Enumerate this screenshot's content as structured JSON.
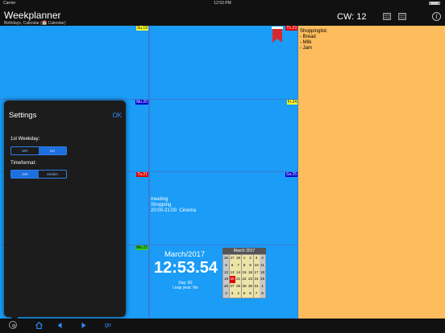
{
  "status_bar": {
    "carrier": "Carrier",
    "time": "12:53 PM"
  },
  "header": {
    "title": "Weekplanner",
    "subtitle": "Birthdays, Calendar (📅 Calendar)",
    "cw": "CW: 12",
    "icons": [
      "calendar-list-icon",
      "calendar-grid-icon",
      "info-icon"
    ]
  },
  "days": [
    {
      "badge": "Su.19",
      "badge_color": "#ffff33",
      "entries": ""
    },
    {
      "badge": "Mo.20",
      "badge_color": "#0000cc",
      "entries": ""
    },
    {
      "badge": "Tu.21",
      "badge_color": "#dd0000",
      "entries": ""
    },
    {
      "badge": "We.22",
      "badge_color": "#33cc33",
      "entries": ""
    },
    {
      "badge": "Th.23",
      "badge_color": "#dd0000",
      "entries": ""
    },
    {
      "badge": "Fr.24",
      "badge_color": "#ffff33",
      "entries": ""
    },
    {
      "badge": "Sa.25",
      "badge_color": "#0000cc",
      "entries": "meeting\nShopping\n20:00-21:00  Cinema"
    }
  ],
  "notes": "Shoppinglist:\n- Bread\n- Milk\n- Jam",
  "clock": {
    "month": "March/2017",
    "time": "12:53.54",
    "day": "Day: 82",
    "leap": "Leap year: No"
  },
  "mini_calendar": {
    "title": "March 2017",
    "cells": [
      "26",
      "27",
      "28",
      "1",
      "2",
      "3",
      "4",
      "5",
      "6",
      "7",
      "8",
      "9",
      "10",
      "11",
      "12",
      "13",
      "14",
      "15",
      "16",
      "17",
      "18",
      "19",
      "20",
      "21",
      "22",
      "23",
      "24",
      "25",
      "26",
      "27",
      "28",
      "29",
      "30",
      "31",
      "1",
      "2",
      "3",
      "4",
      "5",
      "6",
      "7",
      "8"
    ],
    "today_index": 22
  },
  "settings": {
    "title": "Settings",
    "ok": "OK",
    "weekday_label": "1st Weekday:",
    "weekday_options": [
      "MO",
      "SU"
    ],
    "weekday_selected": 1,
    "timeformat_label": "Timeformat:",
    "timeformat_options": [
      "24h",
      "am/pm"
    ],
    "timeformat_selected": 0
  },
  "bottom_bar": {
    "go": "go",
    "icons": [
      "settings-icon",
      "home-icon",
      "prev-icon",
      "next-icon"
    ]
  }
}
